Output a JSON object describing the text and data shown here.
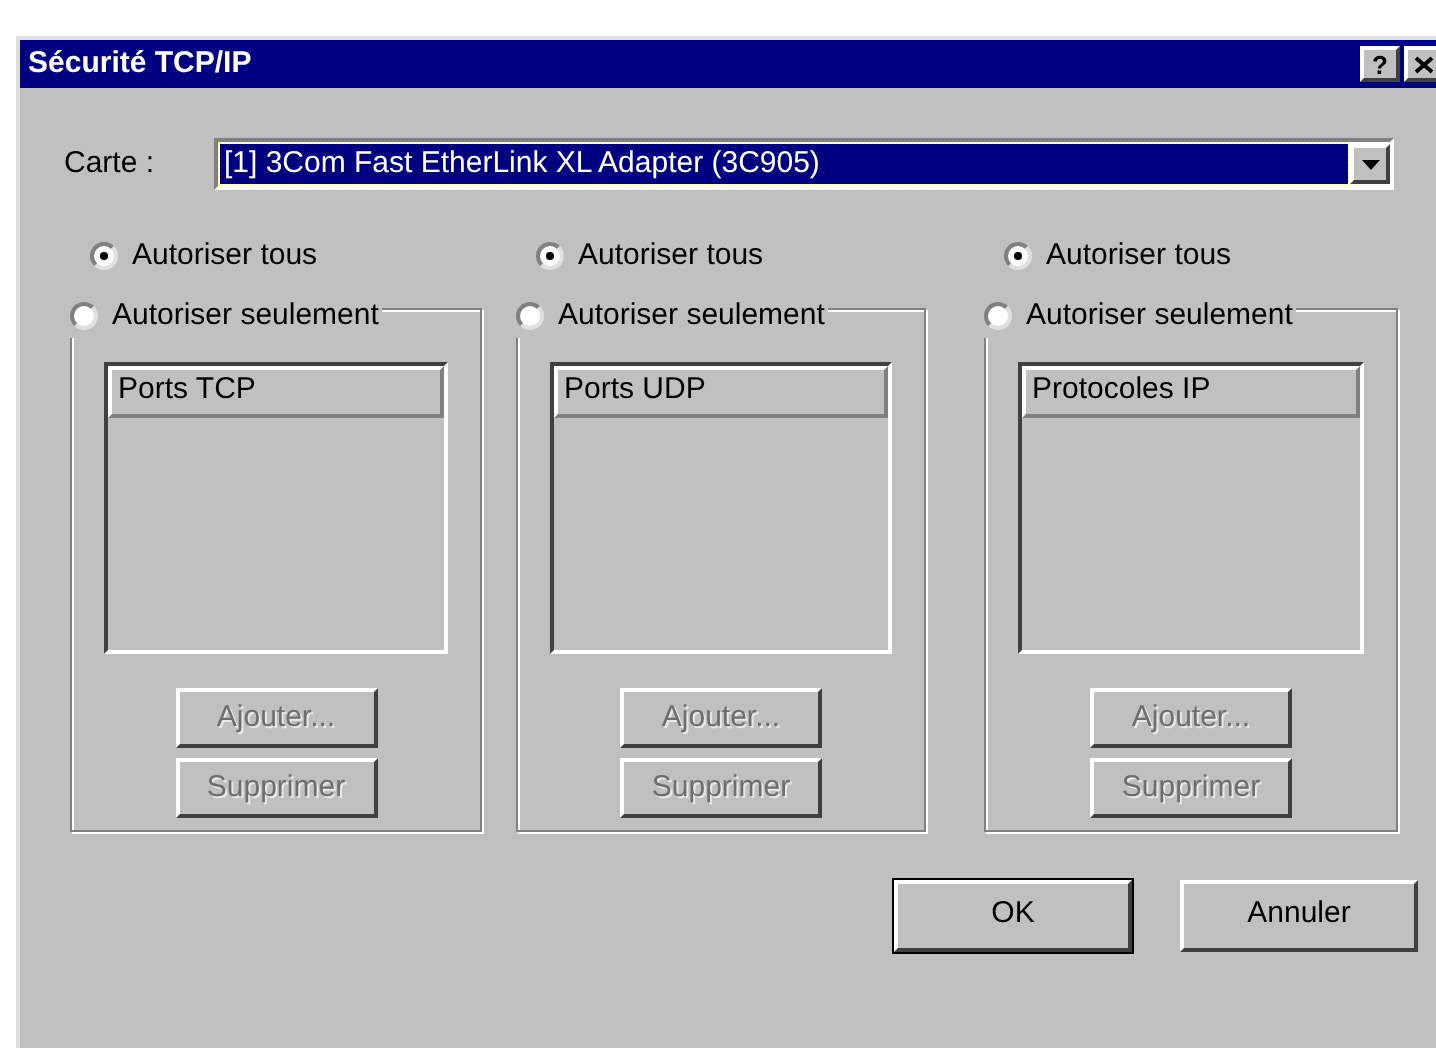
{
  "window": {
    "title": "Sécurité TCP/IP",
    "help_button": "?"
  },
  "adapter": {
    "label": "Carte :",
    "value": "[1] 3Com Fast EtherLink XL Adapter (3C905)",
    "focused": true
  },
  "groups": [
    {
      "radios": [
        {
          "label": "Autoriser tous",
          "selected": true
        },
        {
          "label": "Autoriser seulement",
          "selected": false
        }
      ],
      "list_header": "Ports TCP",
      "buttons": [
        {
          "label": "Ajouter...",
          "disabled": true
        },
        {
          "label": "Supprimer",
          "disabled": true
        }
      ]
    },
    {
      "radios": [
        {
          "label": "Autoriser tous",
          "selected": true
        },
        {
          "label": "Autoriser seulement",
          "selected": false
        }
      ],
      "list_header": "Ports UDP",
      "buttons": [
        {
          "label": "Ajouter...",
          "disabled": true
        },
        {
          "label": "Supprimer",
          "disabled": true
        }
      ]
    },
    {
      "radios": [
        {
          "label": "Autoriser tous",
          "selected": true
        },
        {
          "label": "Autoriser seulement",
          "selected": false
        }
      ],
      "list_header": "Protocoles IP",
      "buttons": [
        {
          "label": "Ajouter...",
          "disabled": true
        },
        {
          "label": "Supprimer",
          "disabled": true
        }
      ]
    }
  ],
  "dialog_buttons": [
    {
      "label": "OK",
      "default": true
    },
    {
      "label": "Annuler",
      "default": false
    }
  ]
}
